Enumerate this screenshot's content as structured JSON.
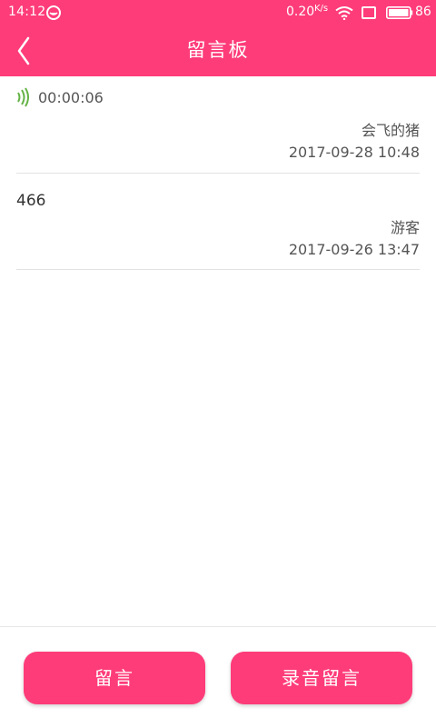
{
  "status_bar": {
    "time": "14:12",
    "net_speed": "0.20",
    "net_speed_unit": "K/s",
    "battery": "86",
    "notification_icon": "chat-bubble-icon",
    "wifi_icon": "wifi-icon",
    "screen_icon": "square-icon",
    "battery_icon": "battery-icon"
  },
  "header": {
    "title": "留言板",
    "back_icon": "back-arrow-icon",
    "background_color": "#fe3c7a"
  },
  "messages": [
    {
      "type": "voice",
      "icon": "voice-waves-icon",
      "content": "00:00:06",
      "author": "会飞的猪",
      "datetime": "2017-09-28  10:48"
    },
    {
      "type": "text",
      "content": "466",
      "author": "游客",
      "datetime": "2017-09-26  13:47"
    }
  ],
  "footer": {
    "message_button": "留言",
    "voice_button": "录音留言",
    "button_color": "#fe3c7a"
  }
}
